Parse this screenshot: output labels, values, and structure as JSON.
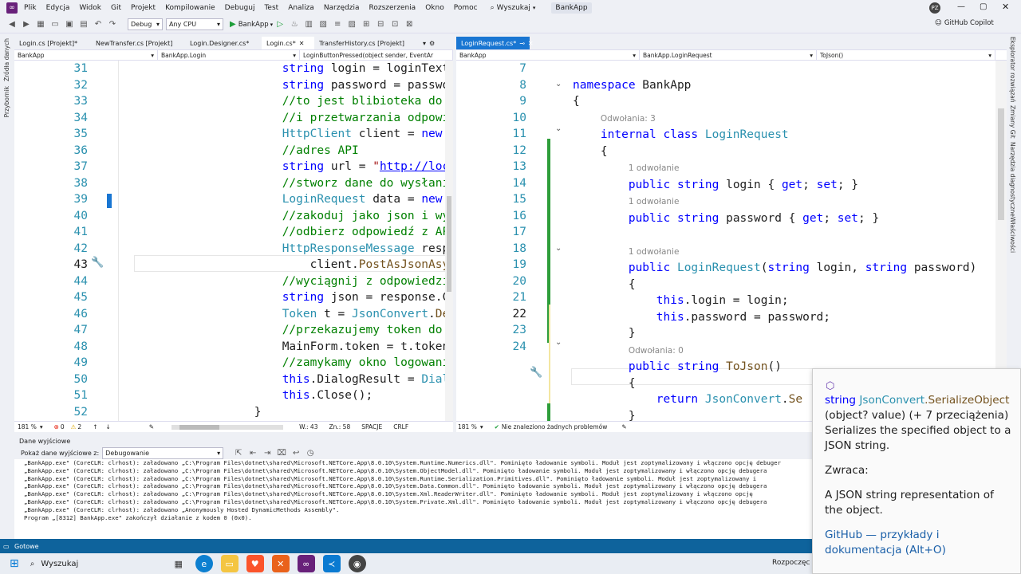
{
  "menu": [
    "Plik",
    "Edycja",
    "Widok",
    "Git",
    "Projekt",
    "Kompilowanie",
    "Debuguj",
    "Test",
    "Analiza",
    "Narzędzia",
    "Rozszerzenia",
    "Okno",
    "Pomoc"
  ],
  "search_label": "Wyszukaj",
  "solution_name": "BankApp",
  "user_initials": "PZ",
  "copilot_label": "GitHub Copilot",
  "toolbar": {
    "config": "Debug",
    "platform": "Any CPU",
    "run_label": "BankApp"
  },
  "left_rail": [
    "Źródła danych",
    "Przybornik"
  ],
  "right_rail": [
    "Eksplorator rozwiązań",
    "Zmiany Git",
    "Narzędzia diagnostyczne",
    "Właściwości"
  ],
  "left_tabs": [
    "Login.cs [Projekt]*",
    "NewTransfer.cs [Projekt]",
    "Login.Designer.cs*",
    "Login.cs*",
    "TransferHistory.cs [Projekt]"
  ],
  "right_tab": "LoginRequest.cs*",
  "left_nav": [
    "BankApp",
    "BankApp.Login",
    "LoginButtonPressed(object sender, EventAr"
  ],
  "right_nav": [
    "BankApp",
    "BankApp.LoginRequest",
    "ToJson()"
  ],
  "left_lines": [
    "31",
    "32",
    "33",
    "34",
    "35",
    "36",
    "37",
    "38",
    "39",
    "40",
    "41",
    "42",
    "43",
    "44",
    "45",
    "46",
    "47",
    "48",
    "49",
    "50",
    "51",
    "52"
  ],
  "right_lines": [
    "7",
    "8",
    "9",
    "10",
    "11",
    "12",
    "13",
    "14",
    "15",
    "16",
    "17",
    "18",
    "19",
    "20",
    "21",
    "22",
    "23",
    "24"
  ],
  "left_status": {
    "zoom": "181 %",
    "errors": "0",
    "warnings": "2",
    "line": "W.: 43",
    "col": "Zn.: 58",
    "spaces": "SPACJE",
    "eol": "CRLF"
  },
  "right_status": {
    "zoom": "181 %",
    "problems": "Nie znaleziono żadnych problemów"
  },
  "code_lens": {
    "refs3": "Odwołania: 3",
    "ref1": "1 odwołanie",
    "refs0": "Odwołania: 0"
  },
  "output": {
    "title": "Dane wyjściowe",
    "show_label": "Pokaż dane wyjściowe z:",
    "source": "Debugowanie",
    "lines": [
      "„BankApp.exe\" (CoreCLR: clrhost): załadowano „C:\\Program Files\\dotnet\\shared\\Microsoft.NETCore.App\\8.0.10\\System.Runtime.Numerics.dll\". Pominięto ładowanie symboli. Moduł jest zoptymalizowany i włączono opcję debuger",
      "„BankApp.exe\" (CoreCLR: clrhost): załadowano „C:\\Program Files\\dotnet\\shared\\Microsoft.NETCore.App\\8.0.10\\System.ObjectModel.dll\". Pominięto ładowanie symboli. Moduł jest zoptymalizowany i włączono opcję debugera",
      "„BankApp.exe\" (CoreCLR: clrhost): załadowano „C:\\Program Files\\dotnet\\shared\\Microsoft.NETCore.App\\8.0.10\\System.Runtime.Serialization.Primitives.dll\". Pominięto ładowanie symboli. Moduł jest zoptymalizowany i",
      "„BankApp.exe\" (CoreCLR: clrhost): załadowano „C:\\Program Files\\dotnet\\shared\\Microsoft.NETCore.App\\8.0.10\\System.Data.Common.dll\". Pominięto ładowanie symboli. Moduł jest zoptymalizowany i włączono opcję debugera",
      "„BankApp.exe\" (CoreCLR: clrhost): załadowano „C:\\Program Files\\dotnet\\shared\\Microsoft.NETCore.App\\8.0.10\\System.Xml.ReaderWriter.dll\". Pominięto ładowanie symboli. Moduł jest zoptymalizowany i włączono opcję",
      "„BankApp.exe\" (CoreCLR: clrhost): załadowano „C:\\Program Files\\dotnet\\shared\\Microsoft.NETCore.App\\8.0.10\\System.Private.Xml.dll\". Pominięto ładowanie symboli. Moduł jest zoptymalizowany i włączono opcję debugera",
      "„BankApp.exe\" (CoreCLR: clrhost): załadowano „Anonymously Hosted DynamicMethods Assembly\".",
      "Program „[8312] BankApp.exe\" zakończył działanie z kodem 0 (0x0)."
    ]
  },
  "status_ready": "Gotowe",
  "taskbar_search": "Wyszukaj",
  "taskbar_right": "Rozpoczęc",
  "tooltip": {
    "sig_type": "string",
    "sig_class": "JsonConvert",
    "sig_method": ".SerializeObject",
    "sig_params": "(object? value) (+ 7 przeciążenia)",
    "desc": "Serializes the specified object to a JSON string.",
    "returns_label": "Zwraca:",
    "returns_desc": "A JSON string representation of the object.",
    "link": "GitHub — przykłady i dokumentacja (Alt+O)"
  },
  "colors": {
    "accent": "#1976d2",
    "vs_purple": "#68217a",
    "status_blue": "#0e639c",
    "keyword": "#0000ff",
    "type": "#2b91af",
    "comment": "#008000",
    "string": "#a31515"
  }
}
